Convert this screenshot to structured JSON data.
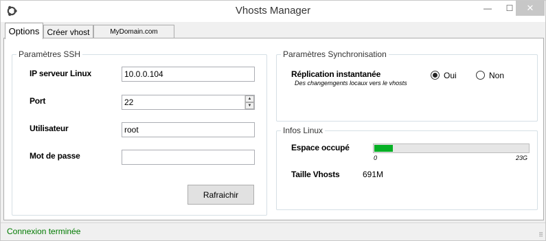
{
  "window": {
    "title": "Vhosts Manager",
    "minimize": "—",
    "maximize": "☐",
    "close": "✕"
  },
  "tabs": [
    {
      "label": "Options"
    },
    {
      "label": "Créer vhost"
    },
    {
      "label": "MyDomain.com"
    }
  ],
  "ssh": {
    "legend": "Paramètres SSH",
    "host_label": "IP serveur Linux",
    "host_value": "10.0.0.104",
    "port_label": "Port",
    "port_value": "22",
    "user_label": "Utilisateur",
    "user_value": "root",
    "password_label": "Mot de passe",
    "password_value": "",
    "refresh_label": "Rafraichir"
  },
  "sync": {
    "legend": "Paramètres Synchronisation",
    "title": "Réplication instantanée",
    "subtitle": "Des changemgents locaux vers le vhosts",
    "options": [
      "Oui",
      "Non"
    ],
    "selected": "Oui"
  },
  "linux": {
    "legend": "Infos Linux",
    "disk_label": "Espace occupé",
    "disk_min": "0",
    "disk_max": "23G",
    "vhosts_label": "Taille Vhosts",
    "vhosts_value": "691M"
  },
  "chart_data": {
    "type": "bar",
    "categories": [
      "Espace occupé"
    ],
    "values": [
      0.12
    ],
    "ylim": [
      0,
      1
    ]
  },
  "status": {
    "text": "Connexion terminée"
  },
  "colors": {
    "status_text": "#007a00",
    "progress_fill": "#06b025",
    "close_button": "#c7c7c7"
  }
}
